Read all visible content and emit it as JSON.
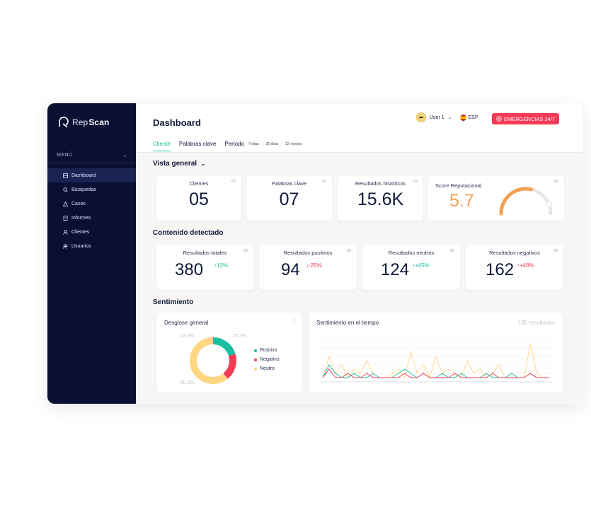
{
  "brand": {
    "part1": "Rep",
    "part2": "Scan"
  },
  "sidebar": {
    "menu_label": "MENÚ",
    "items": [
      {
        "label": "Dashboard",
        "active": true
      },
      {
        "label": "Búsquedas"
      },
      {
        "label": "Casos"
      },
      {
        "label": "Informes"
      },
      {
        "label": "Clientes"
      },
      {
        "label": "Usuarios"
      }
    ]
  },
  "header": {
    "title": "Dashboard",
    "tabs": [
      "Cliente",
      "Palabras clave",
      "Periodo"
    ],
    "periods": [
      "7 días",
      "30 días",
      "12 meses"
    ],
    "user": "User 1",
    "language": "ESP",
    "emergency": "EMERGENCIAS 24/7"
  },
  "overview": {
    "title": "Vista general",
    "cards": [
      {
        "label": "Clientes",
        "value": "05"
      },
      {
        "label": "Palabras clave",
        "value": "07"
      },
      {
        "label": "Resultados históricos",
        "value": "15.6K"
      }
    ],
    "score": {
      "label": "Score Reputacional",
      "value": "5.7",
      "gauge_fraction": 0.57
    }
  },
  "content": {
    "title": "Contenido detectado",
    "cards": [
      {
        "label": "Resultados totales",
        "value": "380",
        "delta": "12%",
        "arrow": "↑"
      },
      {
        "label": "Resultados positivos",
        "value": "94",
        "delta": "-25%",
        "arrow": "↓"
      },
      {
        "label": "Resultados neutros",
        "value": "124",
        "delta": "+45%",
        "arrow": "↑"
      },
      {
        "label": "Resultados negativos",
        "value": "162",
        "delta": "+48%",
        "arrow": "↑"
      }
    ]
  },
  "sentiment": {
    "title": "Sentimiento",
    "breakdown": {
      "title": "Desglose general",
      "legend": [
        "Positivo",
        "Negativo",
        "Neutro"
      ],
      "pct_negative": "18.8%",
      "pct_positive": "20.3%",
      "pct_neutral": "60.9%"
    },
    "timeline": {
      "title": "Sentimiento en el tiempo",
      "results": "138 resultados"
    }
  },
  "colors": {
    "positive": "#19bfa0",
    "negative": "#f43a54",
    "neutral": "#ffd783",
    "accent": "#19bfa0",
    "score": "#f4a052",
    "sidebar": "#0b1033"
  },
  "chart_data": [
    {
      "type": "pie",
      "categories": [
        "Positivo",
        "Negativo",
        "Neutro"
      ],
      "values": [
        20.3,
        18.8,
        60.9
      ]
    },
    {
      "type": "line",
      "title": "Sentimiento en el tiempo",
      "series": [
        {
          "name": "Positivo",
          "values": [
            1,
            4,
            2,
            1,
            1,
            2,
            1,
            1,
            2,
            1,
            1,
            1,
            2,
            3,
            2,
            1,
            2,
            1,
            1,
            2,
            1,
            1,
            2,
            1,
            1,
            1,
            2,
            1,
            1,
            1,
            2,
            1,
            1,
            2,
            1,
            1,
            1
          ]
        },
        {
          "name": "Negativo",
          "values": [
            1,
            3,
            1,
            1,
            2,
            1,
            1,
            2,
            1,
            1,
            1,
            1,
            1,
            2,
            1,
            1,
            2,
            1,
            1,
            1,
            1,
            2,
            1,
            1,
            1,
            1,
            1,
            2,
            1,
            1,
            1,
            1,
            1,
            2,
            1,
            1,
            1
          ]
        },
        {
          "name": "Neutro",
          "values": [
            1,
            6,
            2,
            4,
            1,
            3,
            2,
            5,
            2,
            1,
            1,
            2,
            3,
            1,
            7,
            2,
            4,
            1,
            6,
            2,
            3,
            2,
            1,
            5,
            2,
            3,
            1,
            2,
            4,
            1,
            2,
            1,
            1,
            9,
            2,
            1,
            1
          ]
        }
      ]
    }
  ]
}
